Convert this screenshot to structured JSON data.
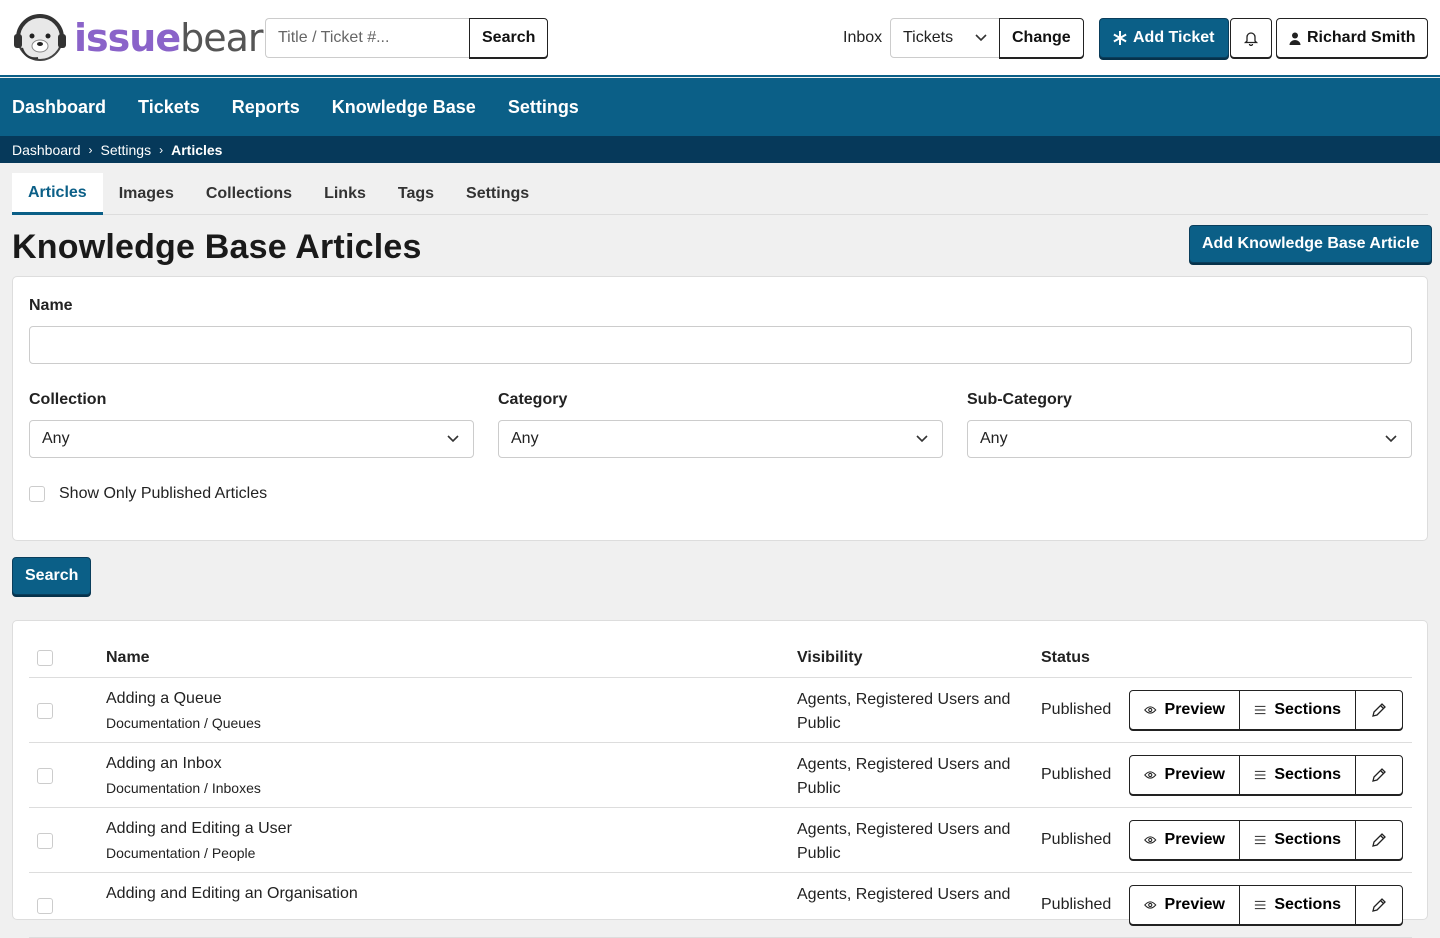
{
  "brand": {
    "part1": "issue",
    "part2": "bear"
  },
  "header": {
    "search_placeholder": "Title / Ticket #...",
    "search_label": "Search",
    "inbox_label": "Inbox",
    "inbox_selected": "Tickets",
    "change_label": "Change",
    "add_ticket_label": "Add Ticket",
    "user_name": "Richard Smith"
  },
  "nav": [
    "Dashboard",
    "Tickets",
    "Reports",
    "Knowledge Base",
    "Settings"
  ],
  "breadcrumb": [
    "Dashboard",
    "Settings",
    "Articles"
  ],
  "tabs": [
    "Articles",
    "Images",
    "Collections",
    "Links",
    "Tags",
    "Settings"
  ],
  "page": {
    "title": "Knowledge Base Articles",
    "add_label": "Add Knowledge Base Article"
  },
  "filters": {
    "name_label": "Name",
    "collection_label": "Collection",
    "collection_value": "Any",
    "category_label": "Category",
    "category_value": "Any",
    "subcategory_label": "Sub-Category",
    "subcategory_value": "Any",
    "published_label": "Show Only Published Articles",
    "search_label": "Search"
  },
  "table": {
    "headers": [
      "Name",
      "Visibility",
      "Status"
    ],
    "actions": {
      "preview": "Preview",
      "sections": "Sections"
    },
    "rows": [
      {
        "name": "Adding a Queue",
        "collection": "Documentation",
        "category": "Queues",
        "visibility": "Agents, Registered Users and Public",
        "status": "Published"
      },
      {
        "name": "Adding an Inbox",
        "collection": "Documentation",
        "category": "Inboxes",
        "visibility": "Agents, Registered Users and Public",
        "status": "Published"
      },
      {
        "name": "Adding and Editing a User",
        "collection": "Documentation",
        "category": "People",
        "visibility": "Agents, Registered Users and Public",
        "status": "Published"
      },
      {
        "name": "Adding and Editing an Organisation",
        "collection": "",
        "category": "",
        "visibility": "Agents, Registered Users and",
        "status": "Published"
      }
    ]
  },
  "colors": {
    "primary": "#0b5f87",
    "dark": "#06395a",
    "brand_purple": "#8a63c9"
  }
}
